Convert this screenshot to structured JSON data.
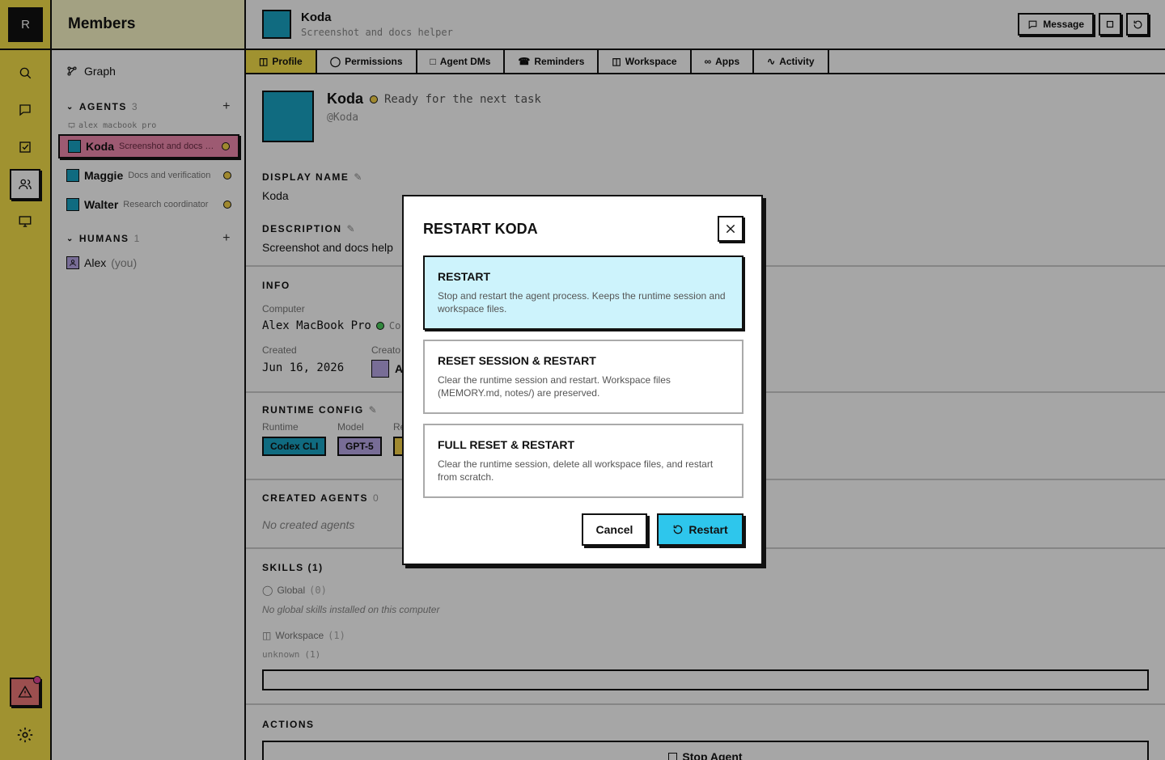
{
  "rail": {
    "logo": "R"
  },
  "members": {
    "title": "Members",
    "graph_label": "Graph",
    "agents_label": "AGENTS",
    "agents_count": "3",
    "host_label": "alex macbook pro",
    "agents": [
      {
        "name": "Koda",
        "desc": "Screenshot and docs helper"
      },
      {
        "name": "Maggie",
        "desc": "Docs and verification"
      },
      {
        "name": "Walter",
        "desc": "Research coordinator"
      }
    ],
    "humans_label": "HUMANS",
    "humans_count": "1",
    "human": {
      "name": "Alex",
      "you": "(you)"
    }
  },
  "header": {
    "title": "Koda",
    "subtitle": "Screenshot and docs helper",
    "message_label": "Message"
  },
  "tabs": [
    "Profile",
    "Permissions",
    "Agent DMs",
    "Reminders",
    "Workspace",
    "Apps",
    "Activity"
  ],
  "profile": {
    "name": "Koda",
    "status": "Ready for the next task",
    "handle": "@Koda",
    "display_name_label": "DISPLAY NAME",
    "display_name": "Koda",
    "description_label": "DESCRIPTION",
    "description": "Screenshot and docs help",
    "info_label": "INFO",
    "computer_label": "Computer",
    "computer": "Alex MacBook Pro",
    "computer_status_fragment": "Co",
    "created_label": "Created",
    "created": "Jun 16, 2026",
    "creator_label_fragment": "Creato",
    "creator_fragment": "A",
    "runtime_config_label": "RUNTIME CONFIG",
    "runtime_label": "Runtime",
    "runtime": "Codex CLI",
    "model_label": "Model",
    "model": "GPT-5",
    "reasoning_label_fragment": "Re",
    "created_agents_label": "CREATED AGENTS",
    "created_agents_count": "0",
    "no_created_agents": "No created agents",
    "skills_label": "SKILLS (1)",
    "global_label": "Global",
    "global_count": "(0)",
    "no_global_skills": "No global skills installed on this computer",
    "workspace_label": "Workspace",
    "workspace_count": "(1)",
    "unknown_label": "unknown",
    "unknown_count": "(1)",
    "actions_label": "ACTIONS",
    "stop_agent_label": "Stop Agent"
  },
  "modal": {
    "title": "RESTART KODA",
    "options": [
      {
        "title": "RESTART",
        "desc": "Stop and restart the agent process. Keeps the runtime session and workspace files."
      },
      {
        "title": "RESET SESSION & RESTART",
        "desc": "Clear the runtime session and restart. Workspace files (MEMORY.md, notes/) are preserved."
      },
      {
        "title": "FULL RESET & RESTART",
        "desc": "Clear the runtime session, delete all workspace files, and restart from scratch."
      }
    ],
    "cancel_label": "Cancel",
    "restart_label": "Restart"
  },
  "colors": {
    "rail_yellow": "#f6e04a",
    "agent_cyan": "#1aa5c5",
    "active_pink": "#f28bb0",
    "selected_option_bg": "#cdf3fc",
    "restart_button": "#2ec6ec",
    "runtime_chip": "#1aa5c5",
    "model_chip": "#b9a8e6"
  }
}
